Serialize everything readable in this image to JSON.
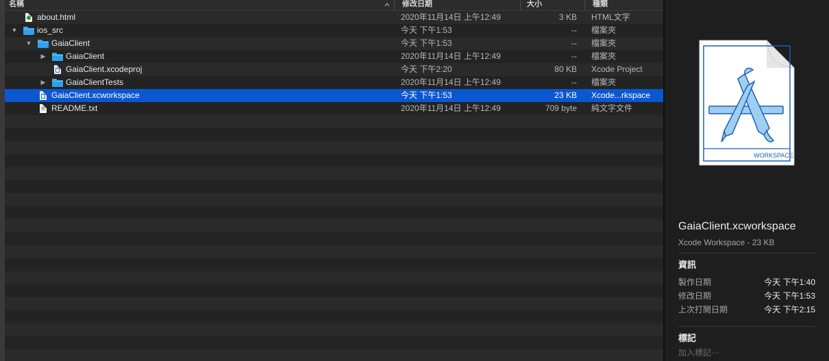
{
  "columns": {
    "name": "名稱",
    "modified": "修改日期",
    "size": "大小",
    "kind": "種類"
  },
  "rows": [
    {
      "name": "about.html",
      "modified": "2020年11月14日 上午12:49",
      "size": "3 KB",
      "kind": "HTML文字",
      "icon": "html-file-icon",
      "indent": 0,
      "disclosure": "none"
    },
    {
      "name": "ios_src",
      "modified": "今天 下午1:53",
      "size": "--",
      "kind": "檔案夾",
      "icon": "folder-icon",
      "indent": 0,
      "disclosure": "expanded"
    },
    {
      "name": "GaiaClient",
      "modified": "今天 下午1:53",
      "size": "--",
      "kind": "檔案夾",
      "icon": "folder-icon",
      "indent": 1,
      "disclosure": "expanded"
    },
    {
      "name": "GaiaClient",
      "modified": "2020年11月14日 上午12:49",
      "size": "--",
      "kind": "檔案夾",
      "icon": "folder-icon",
      "indent": 2,
      "disclosure": "collapsed"
    },
    {
      "name": "GaiaClient.xcodeproj",
      "modified": "今天 下午2:20",
      "size": "80 KB",
      "kind": "Xcode Project",
      "icon": "xcodeproj-file-icon",
      "indent": 2,
      "disclosure": "none"
    },
    {
      "name": "GaiaClientTests",
      "modified": "2020年11月14日 上午12:49",
      "size": "--",
      "kind": "檔案夾",
      "icon": "folder-icon",
      "indent": 2,
      "disclosure": "collapsed"
    },
    {
      "name": "GaiaClient.xcworkspace",
      "modified": "今天 下午1:53",
      "size": "23 KB",
      "kind": "Xcode...rkspace",
      "icon": "xcworkspace-file-icon",
      "indent": 1,
      "disclosure": "none",
      "selected": true
    },
    {
      "name": "README.txt",
      "modified": "2020年11月14日 上午12:49",
      "size": "709 byte",
      "kind": "純文字文件",
      "icon": "text-file-icon",
      "indent": 1,
      "disclosure": "none"
    }
  ],
  "preview": {
    "badge": "WORKSPACE",
    "title": "GaiaClient.xcworkspace",
    "subtitle": "Xcode Workspace - 23 KB",
    "info_heading": "資訊",
    "info": [
      {
        "label": "製作日期",
        "value": "今天 下午1:40"
      },
      {
        "label": "修改日期",
        "value": "今天 下午1:53"
      },
      {
        "label": "上次打開日期",
        "value": "今天 下午2:15"
      }
    ],
    "tags_heading": "標記",
    "tags_placeholder": "加入標記⋯"
  },
  "colors": {
    "selection": "#0b57d0",
    "folder": "#2ea2e8",
    "background": "#1e1e1e"
  }
}
